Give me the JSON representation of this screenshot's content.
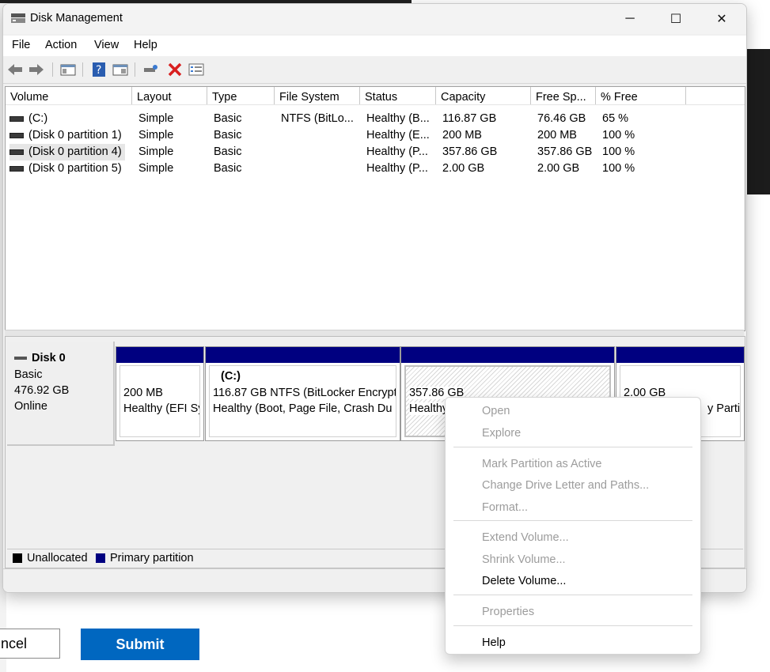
{
  "window": {
    "title": "Disk Management",
    "controls": {
      "minimize": "─",
      "maximize": "☐",
      "close": "✕"
    }
  },
  "menu": [
    "File",
    "Action",
    "View",
    "Help"
  ],
  "toolbar": {
    "icons": [
      "back-arrow-icon",
      "forward-arrow-icon",
      "console-tree-icon",
      "help-icon",
      "show-hide-icon",
      "connect-icon",
      "delete-icon",
      "properties-icon"
    ]
  },
  "volume_list": {
    "columns": [
      "Volume",
      "Layout",
      "Type",
      "File System",
      "Status",
      "Capacity",
      "Free Sp...",
      "% Free"
    ],
    "rows": [
      {
        "volume": "(C:)",
        "layout": "Simple",
        "type": "Basic",
        "fs": "NTFS (BitLo...",
        "status": "Healthy (B...",
        "capacity": "116.87 GB",
        "free": "76.46 GB",
        "pct": "65 %"
      },
      {
        "volume": "(Disk 0 partition 1)",
        "layout": "Simple",
        "type": "Basic",
        "fs": "",
        "status": "Healthy (E...",
        "capacity": "200 MB",
        "free": "200 MB",
        "pct": "100 %"
      },
      {
        "volume": "(Disk 0 partition 4)",
        "layout": "Simple",
        "type": "Basic",
        "fs": "",
        "status": "Healthy (P...",
        "capacity": "357.86 GB",
        "free": "357.86 GB",
        "pct": "100 %"
      },
      {
        "volume": "(Disk 0 partition 5)",
        "layout": "Simple",
        "type": "Basic",
        "fs": "",
        "status": "Healthy (P...",
        "capacity": "2.00 GB",
        "free": "2.00 GB",
        "pct": "100 %"
      }
    ]
  },
  "disk": {
    "name": "Disk 0",
    "kind": "Basic",
    "size": "476.92 GB",
    "state": "Online",
    "partitions": [
      {
        "title": "",
        "line1": "200 MB",
        "line2": "Healthy (EFI Sy"
      },
      {
        "title": "(C:)",
        "line1": "116.87 GB NTFS (BitLocker Encrypt",
        "line2": "Healthy (Boot, Page File, Crash Du"
      },
      {
        "title": "",
        "line1": "357.86 GB",
        "line2": "Healthy"
      },
      {
        "title": "",
        "line1": "2.00 GB",
        "line2": "y Parti"
      }
    ]
  },
  "legend": {
    "unallocated": "Unallocated",
    "primary": "Primary partition"
  },
  "colors": {
    "primary_band": "#000080",
    "unallocated": "#000000",
    "submit_bg": "#0067c0"
  },
  "context_menu": {
    "items": [
      {
        "label": "Open",
        "enabled": false
      },
      {
        "label": "Explore",
        "enabled": false
      },
      {
        "label": "Mark Partition as Active",
        "enabled": false
      },
      {
        "label": "Change Drive Letter and Paths...",
        "enabled": false
      },
      {
        "label": "Format...",
        "enabled": false
      },
      {
        "label": "Extend Volume...",
        "enabled": false
      },
      {
        "label": "Shrink Volume...",
        "enabled": false
      },
      {
        "label": "Delete Volume...",
        "enabled": true
      },
      {
        "label": "Properties",
        "enabled": false
      },
      {
        "label": "Help",
        "enabled": true
      }
    ]
  },
  "dialog_buttons": {
    "cancel": "ncel",
    "submit": "Submit"
  }
}
